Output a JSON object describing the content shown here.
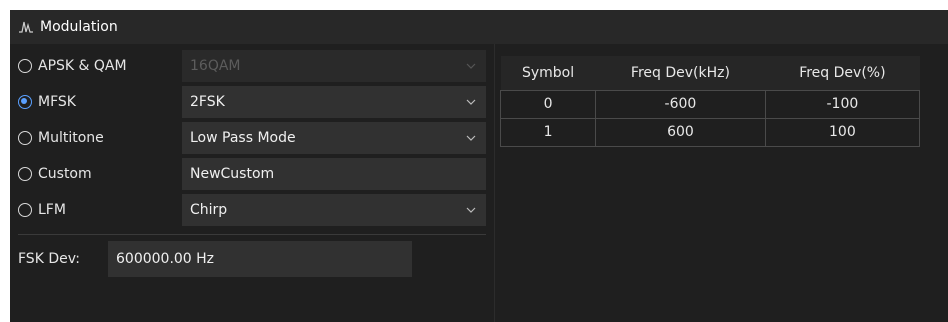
{
  "window": {
    "title": "Modulation",
    "title_icon": "waveform-icon"
  },
  "modulation": {
    "options": [
      {
        "label": "APSK & QAM",
        "checked": false,
        "value": "16QAM",
        "type": "dropdown",
        "disabled": true
      },
      {
        "label": "MFSK",
        "checked": true,
        "value": "2FSK",
        "type": "dropdown",
        "disabled": false
      },
      {
        "label": "Multitone",
        "checked": false,
        "value": "Low Pass Mode",
        "type": "dropdown",
        "disabled": false
      },
      {
        "label": "Custom",
        "checked": false,
        "value": "NewCustom",
        "type": "text",
        "disabled": false
      },
      {
        "label": "LFM",
        "checked": false,
        "value": "Chirp",
        "type": "dropdown",
        "disabled": false
      }
    ],
    "fsk_dev": {
      "label": "FSK Dev:",
      "value": "600000.00 Hz"
    }
  },
  "table": {
    "headers": [
      "Symbol",
      "Freq Dev(kHz)",
      "Freq Dev(%)"
    ],
    "rows": [
      [
        "0",
        "-600",
        "-100"
      ],
      [
        "1",
        "600",
        "100"
      ]
    ]
  },
  "colors": {
    "background": "#1f1f1f",
    "titlebar": "#282828",
    "field": "#313131",
    "accent": "#5aa0ff"
  }
}
